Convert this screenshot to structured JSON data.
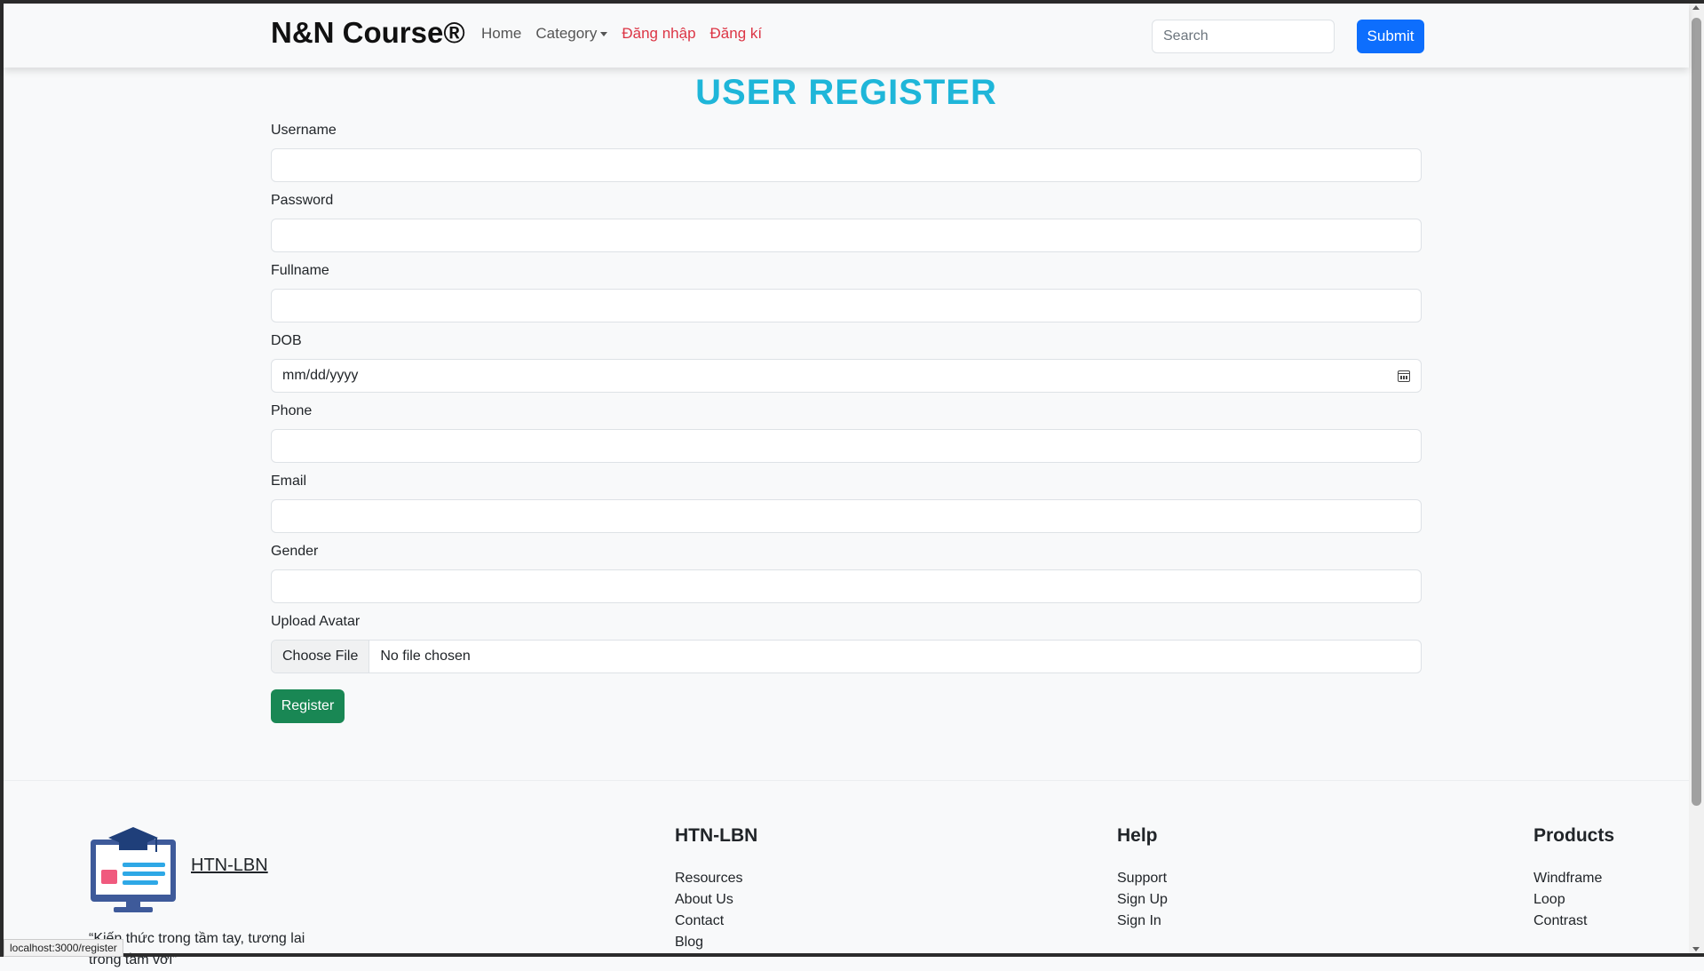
{
  "navbar": {
    "brand": "N&N Course®",
    "links": [
      {
        "label": "Home"
      },
      {
        "label": "Category"
      },
      {
        "label": "Đăng nhập"
      },
      {
        "label": "Đăng kí"
      }
    ],
    "search_placeholder": "Search",
    "submit_label": "Submit"
  },
  "form": {
    "title": "USER REGISTER",
    "fields": {
      "username": "Username",
      "password": "Password",
      "fullname": "Fullname",
      "dob": "DOB",
      "dob_placeholder": "mm/dd/yyyy",
      "phone": "Phone",
      "email": "Email",
      "gender": "Gender",
      "avatar": "Upload Avatar",
      "choose_file": "Choose File",
      "no_file": "No file chosen"
    },
    "register_label": "Register"
  },
  "footer": {
    "logo_text": "HTN-LBN",
    "tagline": "“Kiến thức trong tầm tay, tương lai trong tầm với”",
    "columns": [
      {
        "title": "HTN-LBN",
        "links": [
          "Resources",
          "About Us",
          "Contact",
          "Blog"
        ]
      },
      {
        "title": "Help",
        "links": [
          "Support",
          "Sign Up",
          "Sign In"
        ]
      },
      {
        "title": "Products",
        "links": [
          "Windframe",
          "Loop",
          "Contrast"
        ]
      }
    ]
  },
  "status_url": "localhost:3000/register",
  "colors": {
    "primary": "#0d6efd",
    "success": "#198754",
    "title": "#1fb6d9",
    "danger": "#dc3545"
  }
}
